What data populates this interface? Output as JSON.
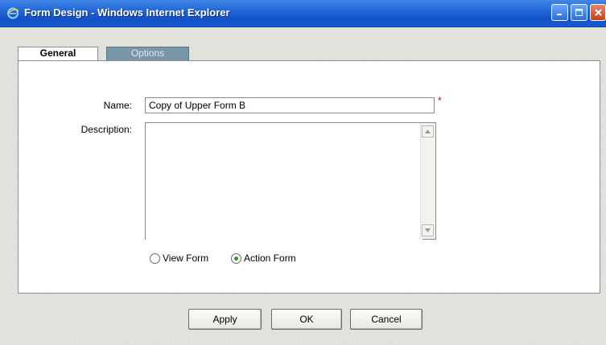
{
  "window": {
    "title": "Form Design - Windows Internet Explorer"
  },
  "tabs": [
    {
      "label": "General"
    },
    {
      "label": "Options"
    }
  ],
  "form": {
    "name_label": "Name:",
    "name_value": "Copy of Upper Form B",
    "required_mark": "*",
    "description_label": "Description:",
    "description_value": ""
  },
  "form_type": {
    "options": [
      {
        "label": "View Form",
        "selected": false
      },
      {
        "label": "Action Form",
        "selected": true
      }
    ]
  },
  "buttons": {
    "apply": "Apply",
    "ok": "OK",
    "cancel": "Cancel"
  }
}
